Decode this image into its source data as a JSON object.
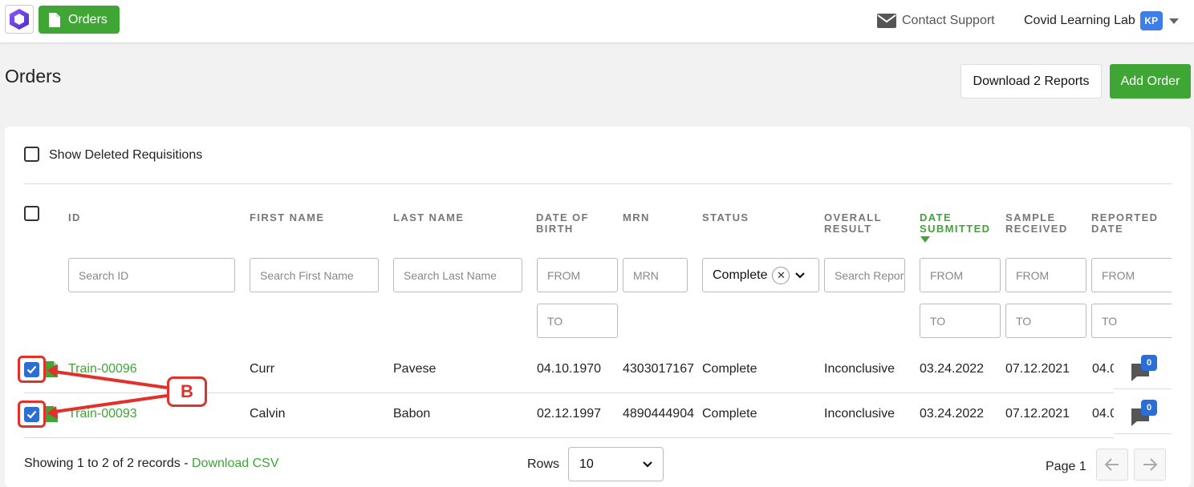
{
  "header": {
    "nav_orders_label": "Orders",
    "contact_support": "Contact Support",
    "account_name": "Covid Learning Lab",
    "account_initials": "KP"
  },
  "page": {
    "title": "Orders",
    "download_reports_label": "Download 2 Reports",
    "add_order_label": "Add Order"
  },
  "table": {
    "show_deleted_label": "Show Deleted Requisitions",
    "headers": {
      "id": "ID",
      "first_name": "FIRST NAME",
      "last_name": "LAST NAME",
      "dob_1": "DATE OF",
      "dob_2": "BIRTH",
      "mrn": "MRN",
      "status": "STATUS",
      "overall_1": "OVERALL",
      "overall_2": "RESULT",
      "date_sub_1": "DATE",
      "date_sub_2": "SUBMITTED",
      "sample_1": "SAMPLE",
      "sample_2": "RECEIVED",
      "reported_1": "REPORTED",
      "reported_2": "DATE"
    },
    "filters": {
      "search_id": "Search ID",
      "search_first": "Search First Name",
      "search_last": "Search Last Name",
      "dob_from": "FROM",
      "dob_to": "TO",
      "mrn": "MRN",
      "status_value": "Complete",
      "search_report": "Search Report",
      "date_sub_from": "FROM",
      "date_sub_to": "TO",
      "sample_from": "FROM",
      "sample_to": "TO",
      "reported_from": "FROM",
      "reported_to": "TO"
    },
    "rows": [
      {
        "id": "Train-00096",
        "first_name": "Curr",
        "last_name": "Pavese",
        "dob": "04.10.1970",
        "mrn": "4303017167",
        "status": "Complete",
        "overall_result": "Inconclusive",
        "date_submitted": "03.24.2022",
        "sample_received": "07.12.2021",
        "reported_date": "04.0",
        "comments": "0",
        "selected": true
      },
      {
        "id": "Train-00093",
        "first_name": "Calvin",
        "last_name": "Babon",
        "dob": "02.12.1997",
        "mrn": "4890444904",
        "status": "Complete",
        "overall_result": "Inconclusive",
        "date_submitted": "03.24.2022",
        "sample_received": "07.12.2021",
        "reported_date": "04.0",
        "comments": "0",
        "selected": true
      }
    ]
  },
  "footer": {
    "showing_text": "Showing 1 to 2 of 2 records - ",
    "download_csv": "Download CSV",
    "rows_label": "Rows",
    "rows_value": "10",
    "page_label": "Page 1"
  },
  "annotation": {
    "label": "B",
    "color": "#e0322b"
  },
  "colors": {
    "brand_green": "#3fa535",
    "accent_blue": "#2b6fd6"
  }
}
